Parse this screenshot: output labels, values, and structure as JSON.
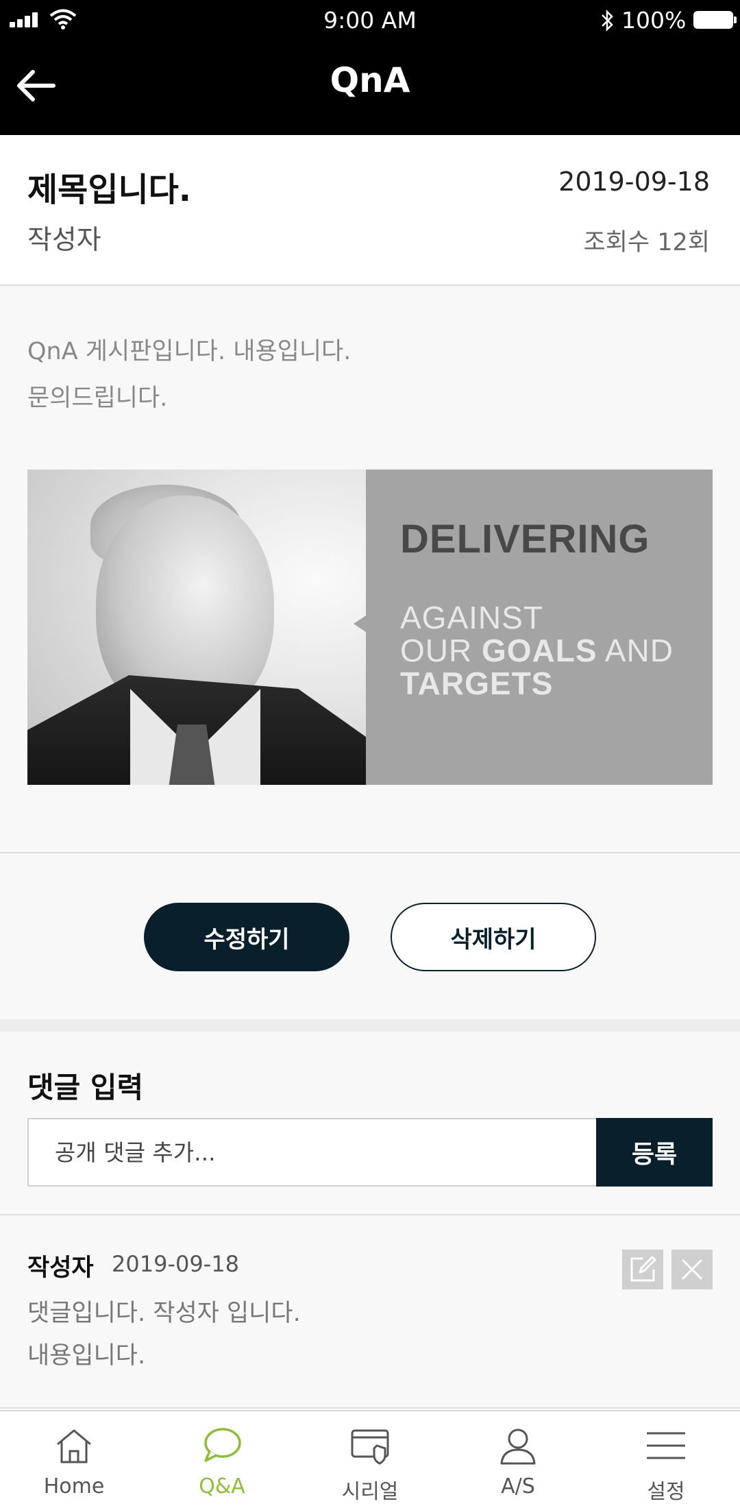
{
  "status_bar": {
    "time": "9:00 AM",
    "battery": "100%"
  },
  "header": {
    "title": "QnA"
  },
  "post": {
    "title": "제목입니다.",
    "date": "2019-09-18",
    "author": "작성자",
    "views": "조회수 12회",
    "body_lines": [
      "QnA 게시판입니다. 내용입니다.",
      "문의드립니다."
    ],
    "image_text": {
      "line1": "DELIVERING",
      "line2": "AGAINST",
      "line3_pre": "OUR ",
      "line3_bold": "GOALS",
      "line3_post": " AND",
      "line4": "TARGETS"
    }
  },
  "actions": {
    "edit_label": "수정하기",
    "delete_label": "삭제하기"
  },
  "comment_input": {
    "label": "댓글 입력",
    "placeholder": "공개 댓글 추가...",
    "submit_label": "등록"
  },
  "comments": [
    {
      "author": "작성자",
      "date": "2019-09-18",
      "lines": [
        "댓글입니다. 작성자 입니다.",
        "내용입니다."
      ]
    }
  ],
  "bottom_nav": {
    "active": "Q&A",
    "accent_color": "#8dbd3a",
    "items": [
      {
        "label": "Home",
        "icon": "home-icon"
      },
      {
        "label": "Q&A",
        "icon": "chat-bubble-icon"
      },
      {
        "label": "시리얼",
        "icon": "serial-card-icon"
      },
      {
        "label": "A/S",
        "icon": "person-icon"
      },
      {
        "label": "설정",
        "icon": "menu-icon"
      }
    ]
  },
  "colors": {
    "primary_dark": "#0a1f2c",
    "header_bg": "#000000"
  }
}
